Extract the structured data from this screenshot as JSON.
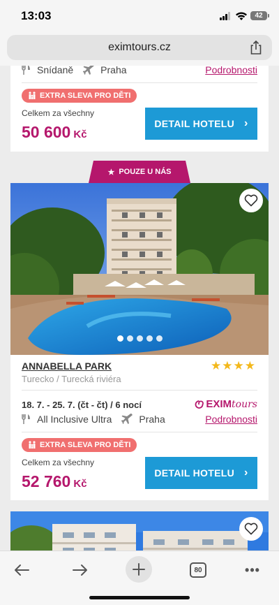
{
  "status_bar": {
    "time": "13:03",
    "battery": "42"
  },
  "browser": {
    "url": "eximtours.cz"
  },
  "card1": {
    "meal": "Snídaně",
    "departure": "Praha",
    "details_link": "Podrobnosti",
    "kids_badge": "EXTRA SLEVA PRO DĚTI",
    "total_label": "Celkem za všechny",
    "price": "50 600",
    "currency": "Kč",
    "button": "DETAIL HOTELU"
  },
  "exclusive_tab": "POUZE U NÁS",
  "card2": {
    "hotel_name": "ANNABELLA PARK",
    "stars": "★★★★",
    "location": "Turecko / Turecká riviéra",
    "dates": "18. 7. - 25. 7. (čt - čt) / 6 nocí",
    "brand_main": "EXIM",
    "brand_tours": "tours",
    "meal": "All Inclusive Ultra",
    "departure": "Praha",
    "details_link": "Podrobnosti",
    "kids_badge": "EXTRA SLEVA PRO DĚTI",
    "total_label": "Celkem za všechny",
    "price": "52 760",
    "currency": "Kč",
    "button": "DETAIL HOTELU",
    "photo_count": 5,
    "active_photo": 1
  },
  "toolbar": {
    "tabs_count": "80"
  },
  "colors": {
    "brand": "#b5176c",
    "button": "#1d9ad6",
    "kids_badge": "#f06f6f",
    "stars": "#f3b81b"
  }
}
